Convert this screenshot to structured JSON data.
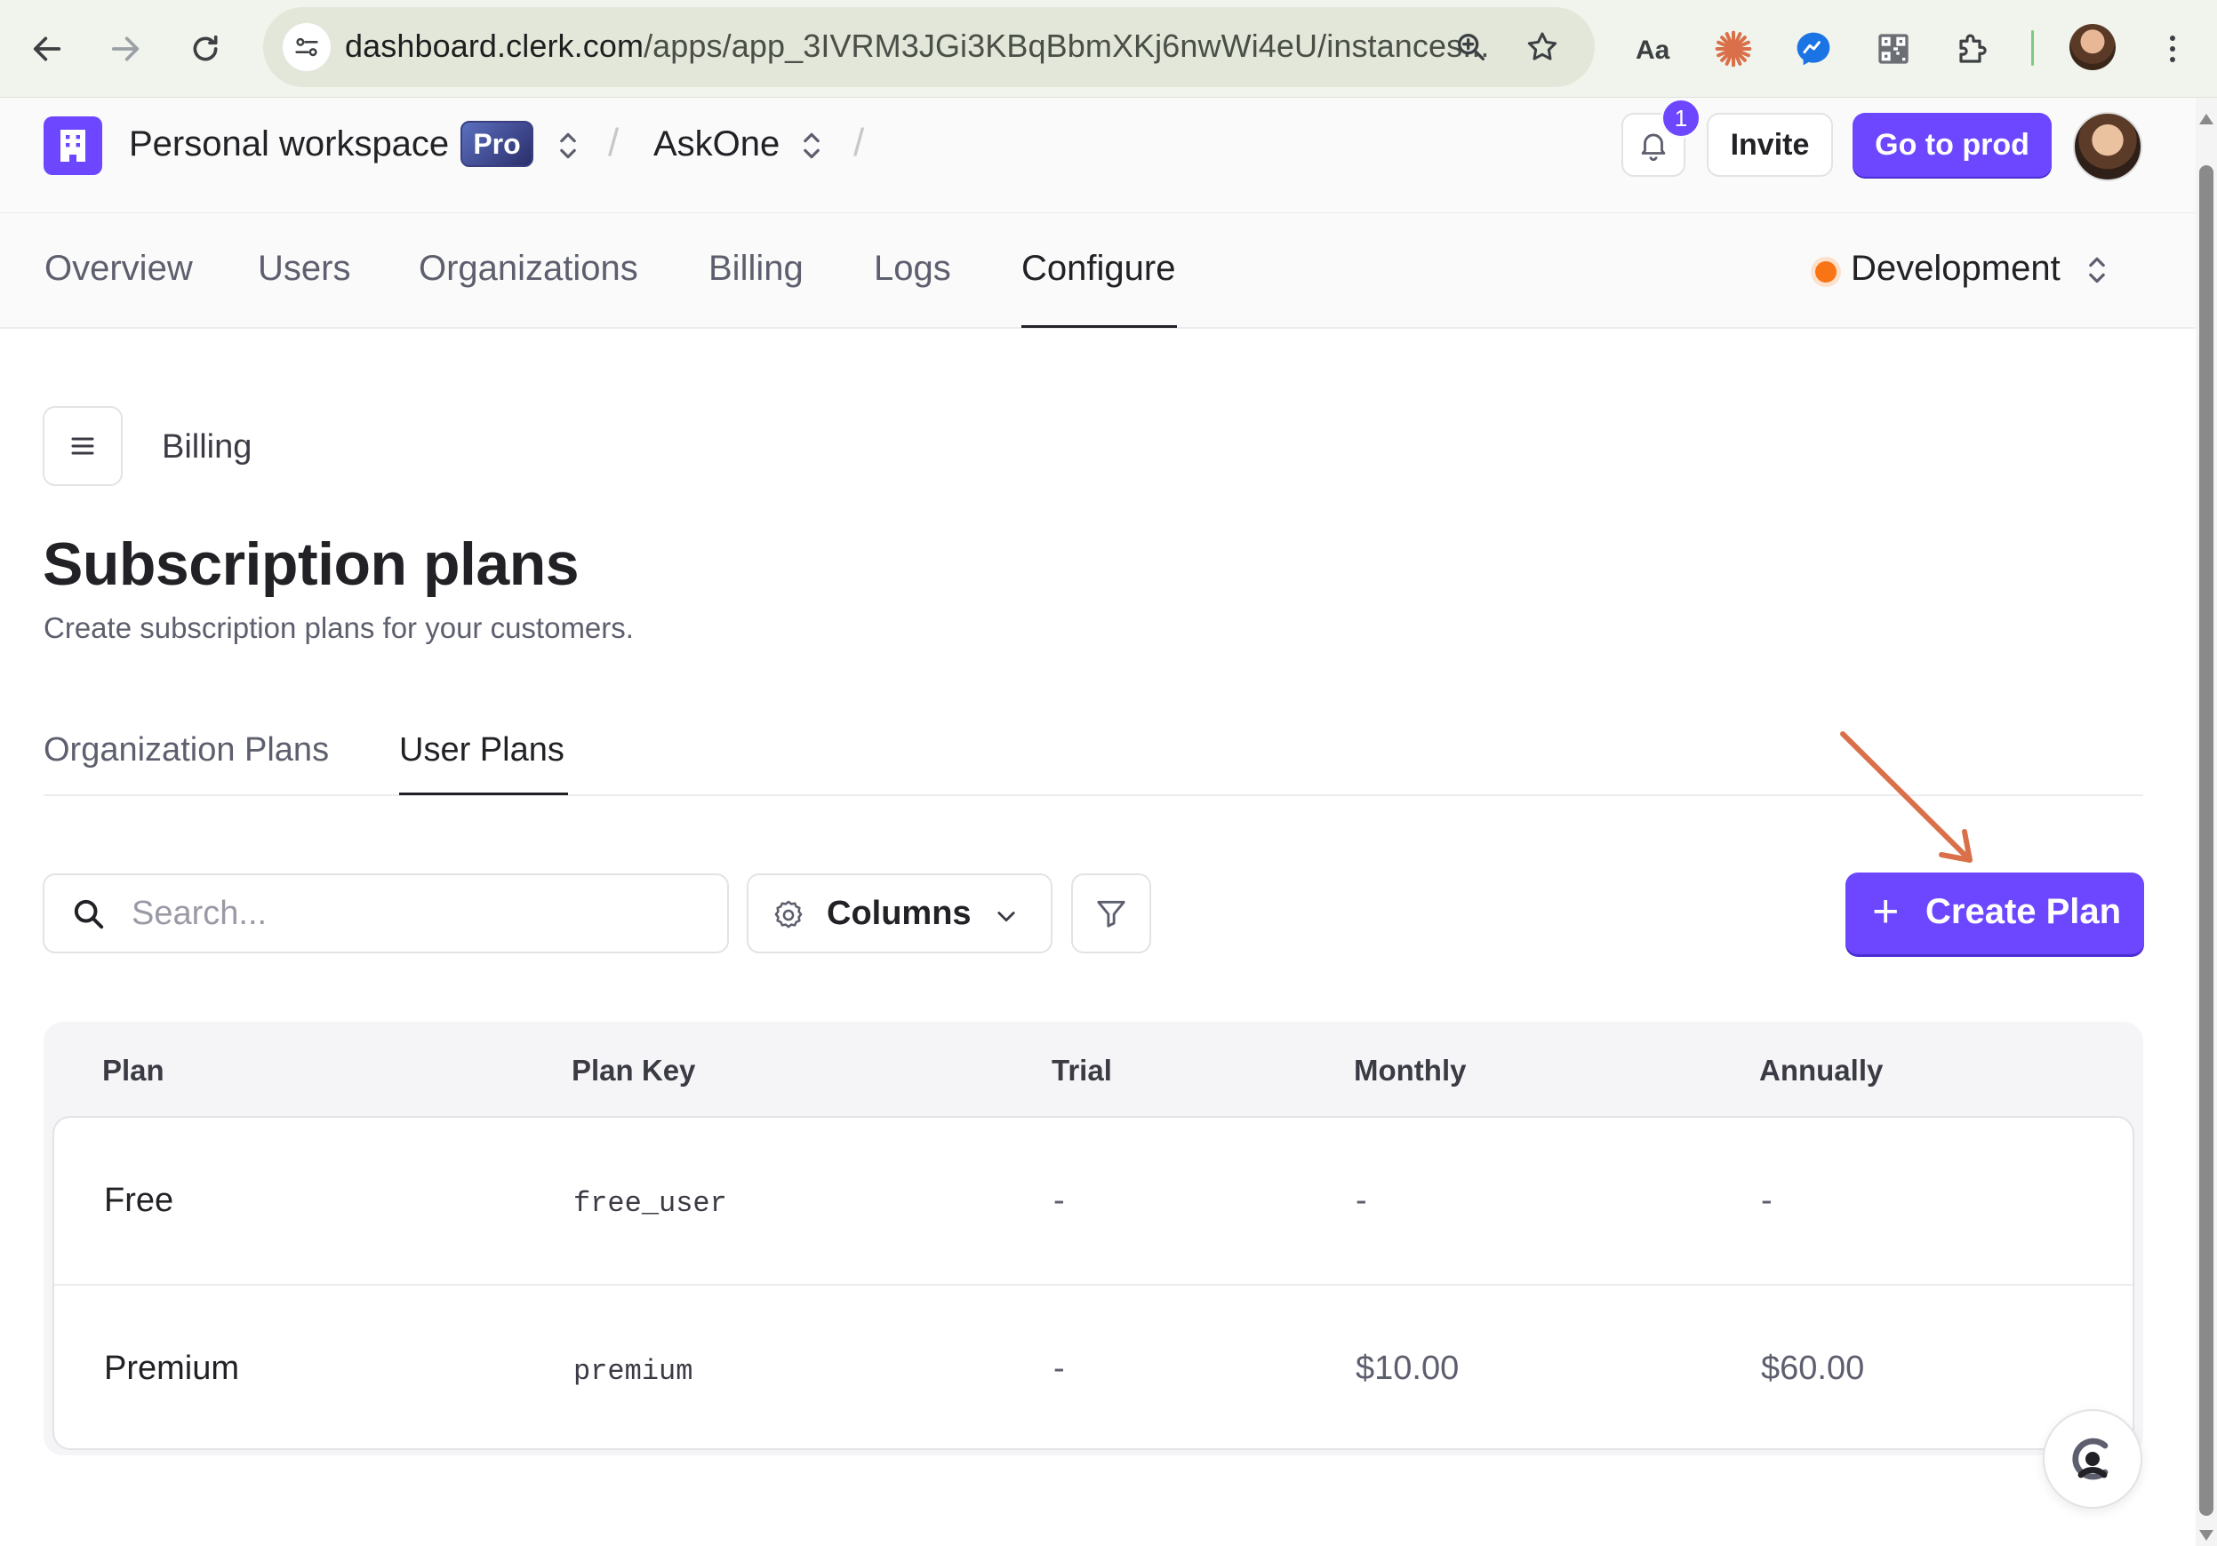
{
  "browser": {
    "url_host": "dashboard.clerk.com",
    "url_path": "/apps/app_3IVRM3JGi3KBqBbmXKj6nwWi4eU/instances...",
    "icons": [
      "back-icon",
      "forward-icon",
      "reload-icon",
      "site-settings-icon",
      "zoom-icon",
      "bookmark-star-icon",
      "reader-mode-icon",
      "claude-icon",
      "messenger-icon",
      "qr-code-icon",
      "extensions-puzzle-icon",
      "chrome-menu-icon"
    ]
  },
  "header": {
    "workspace_name": "Personal workspace",
    "plan_badge": "Pro",
    "app_name": "AskOne",
    "notification_count": "1",
    "invite_label": "Invite",
    "go_to_prod_label": "Go to prod"
  },
  "nav": {
    "tabs": [
      {
        "label": "Overview"
      },
      {
        "label": "Users"
      },
      {
        "label": "Organizations"
      },
      {
        "label": "Billing"
      },
      {
        "label": "Logs"
      },
      {
        "label": "Configure",
        "active": true
      }
    ],
    "environment": "Development",
    "environment_color": "#f97415"
  },
  "page": {
    "breadcrumb": "Billing",
    "title": "Subscription plans",
    "subtitle": "Create subscription plans for your customers.",
    "tabs": [
      {
        "label": "Organization Plans"
      },
      {
        "label": "User Plans",
        "active": true
      }
    ],
    "search_placeholder": "Search...",
    "columns_label": "Columns",
    "create_plan_label": "Create Plan",
    "create_plan_icon": "+"
  },
  "table": {
    "headers": [
      "Plan",
      "Plan Key",
      "Trial",
      "Monthly",
      "Annually"
    ],
    "rows": [
      {
        "plan": "Free",
        "key": "free_user",
        "trial": "-",
        "monthly": "-",
        "annually": "-"
      },
      {
        "plan": "Premium",
        "key": "premium",
        "trial": "-",
        "monthly": "$10.00",
        "annually": "$60.00"
      }
    ]
  },
  "colors": {
    "accent": "#6c47ff",
    "annotation_arrow": "#d9704a"
  }
}
